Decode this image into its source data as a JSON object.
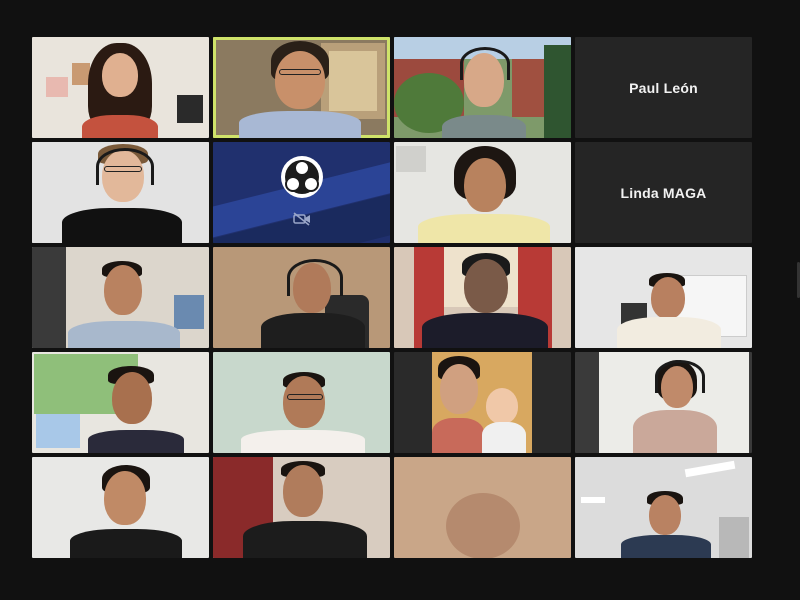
{
  "participants": [
    {
      "id": "p1",
      "type": "video",
      "active": false
    },
    {
      "id": "p2",
      "type": "video",
      "active": true
    },
    {
      "id": "p3",
      "type": "video",
      "active": false
    },
    {
      "id": "p4",
      "type": "name",
      "name": "Paul León",
      "active": false
    },
    {
      "id": "p5",
      "type": "video",
      "active": false
    },
    {
      "id": "p6",
      "type": "logo",
      "logo": "obs-logo",
      "camera_icon": "camera-off-icon",
      "active": false
    },
    {
      "id": "p7",
      "type": "video",
      "active": false
    },
    {
      "id": "p8",
      "type": "name",
      "name": "Linda MAGA",
      "active": false
    },
    {
      "id": "p9",
      "type": "video",
      "active": false
    },
    {
      "id": "p10",
      "type": "video",
      "active": false
    },
    {
      "id": "p11",
      "type": "video",
      "active": false
    },
    {
      "id": "p12",
      "type": "video",
      "active": false
    },
    {
      "id": "p13",
      "type": "video",
      "active": false
    },
    {
      "id": "p14",
      "type": "video",
      "active": false
    },
    {
      "id": "p15",
      "type": "video",
      "active": false
    },
    {
      "id": "p16",
      "type": "video",
      "active": false
    },
    {
      "id": "p17",
      "type": "video",
      "active": false
    },
    {
      "id": "p18",
      "type": "video",
      "active": false
    },
    {
      "id": "p19",
      "type": "video",
      "active": false
    },
    {
      "id": "p20",
      "type": "video",
      "active": false
    }
  ],
  "colors": {
    "background": "#111111",
    "name_tile": "#252525",
    "active_speaker_border": "#cfe36a",
    "name_text": "#f2f2f2"
  }
}
